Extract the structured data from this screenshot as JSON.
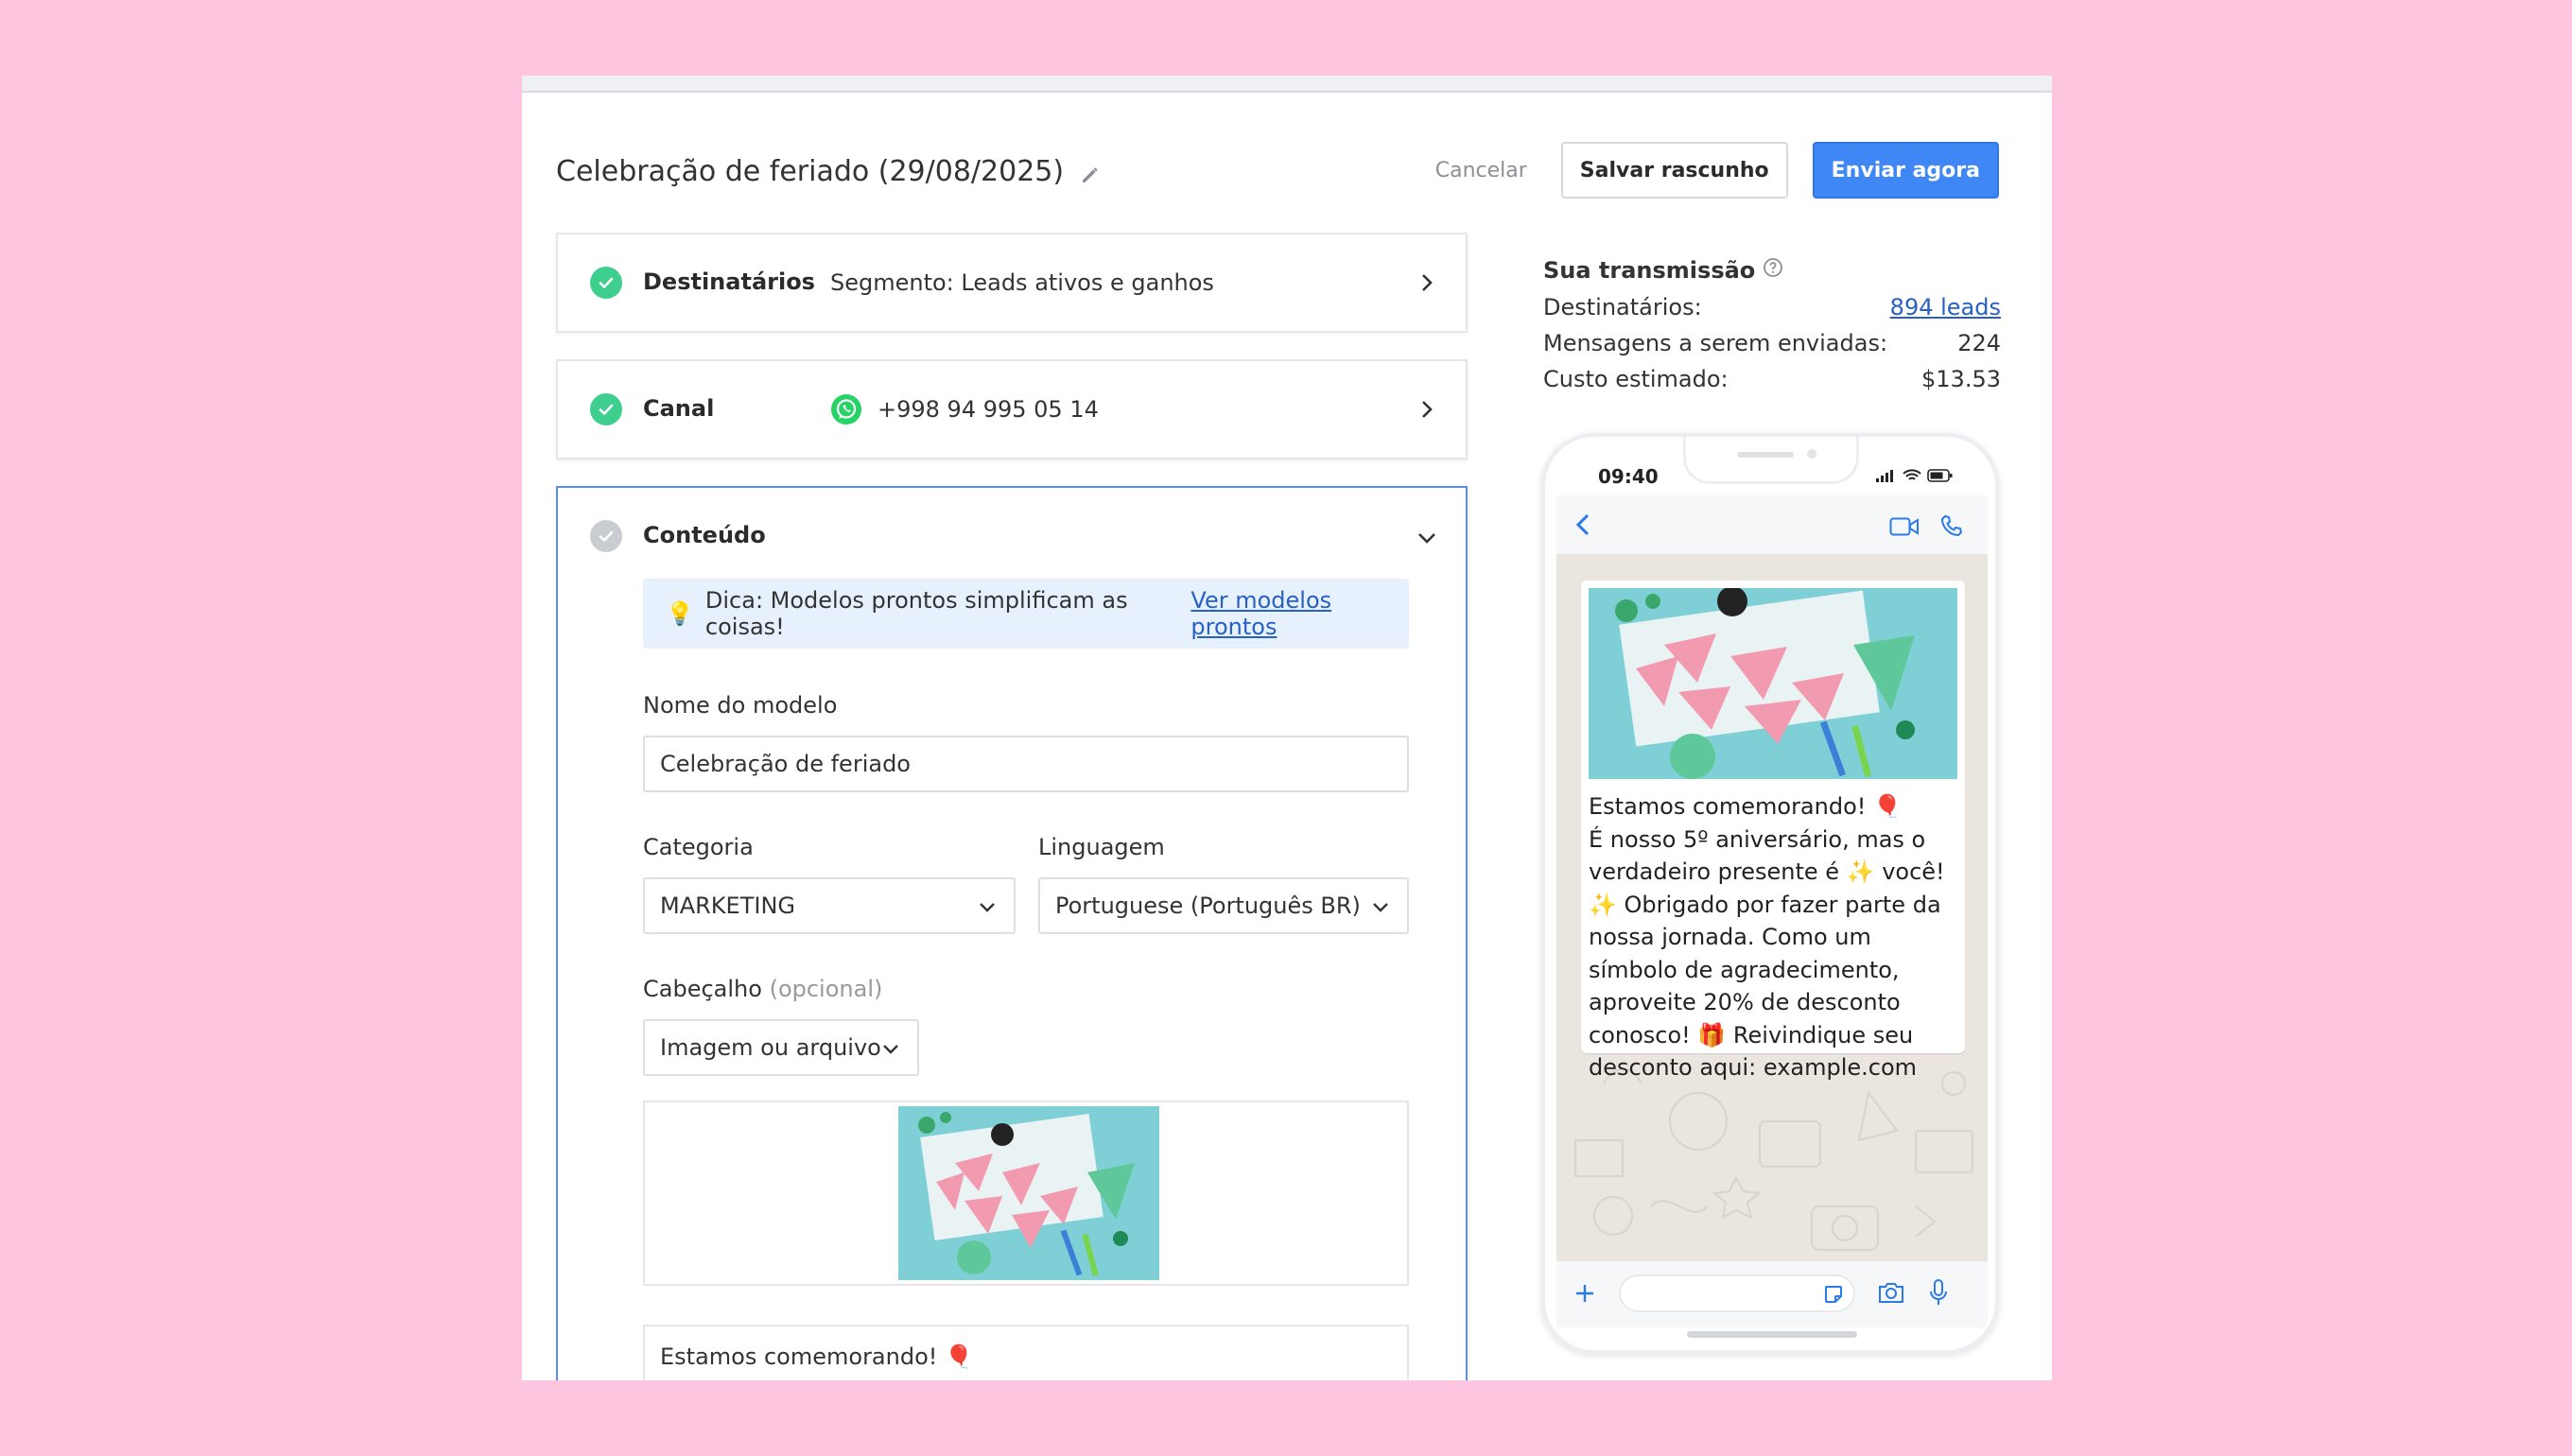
{
  "campaign": {
    "title": "Celebração de feriado (29/08/2025)",
    "cancel": "Cancelar",
    "save_draft": "Salvar rascunho",
    "send_now": "Enviar agora"
  },
  "recipients": {
    "label": "Destinatários",
    "value": "Segmento: Leads ativos e ganhos"
  },
  "channel": {
    "label": "Canal",
    "value": "+998 94 995 05 14"
  },
  "content": {
    "label": "Conteúdo",
    "tip_text": "Dica: Modelos prontos simplificam as coisas!",
    "tip_link": "Ver modelos prontos",
    "template_name_label": "Nome do modelo",
    "template_name_value": "Celebração de feriado",
    "category_label": "Categoria",
    "category_value": "MARKETING",
    "language_label": "Linguagem",
    "language_value": "Portuguese (Português BR)",
    "header_label": "Cabeçalho",
    "header_optional": "(opcional)",
    "header_value": "Imagem ou arquivo",
    "message_first_line": "Estamos comemorando! 🎈"
  },
  "summary": {
    "title": "Sua transmissão",
    "recipients_label": "Destinatários:",
    "recipients_value": "894 leads",
    "messages_label": "Mensagens a serem enviadas:",
    "messages_value": "224",
    "cost_label": "Custo estimado:",
    "cost_value": "$13.53"
  },
  "phone": {
    "time": "09:40",
    "message": "Estamos comemorando! 🎈\nÉ nosso 5º aniversário, mas o verdadeiro presente é ✨ você! ✨ Obrigado por fazer parte da nossa jornada. Como um símbolo de agradecimento, aproveite 20% de desconto conosco! 🎁 Reivindique seu desconto aqui: example.com"
  },
  "colors": {
    "background": "#fdc6de",
    "primary": "#3f87f5",
    "success": "#3ecf8e",
    "link": "#2761c4",
    "whatsapp": "#25d366"
  }
}
